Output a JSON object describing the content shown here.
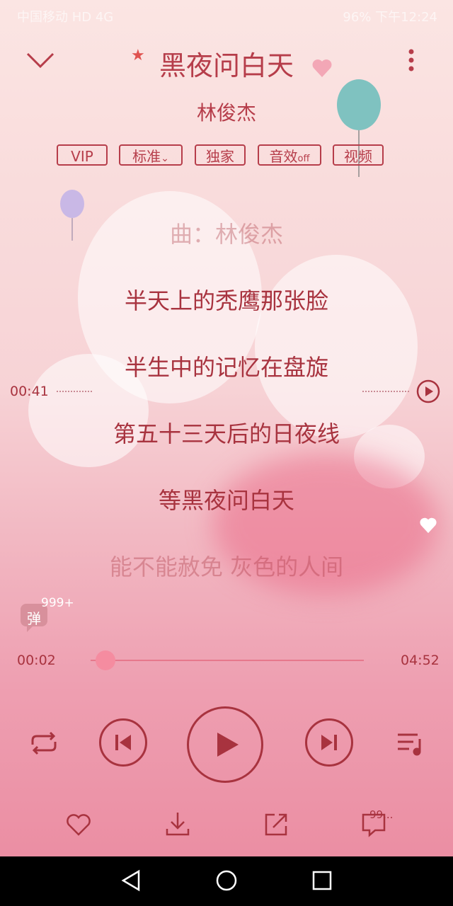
{
  "status_bar": {
    "left": "中国移动 HD 4G",
    "right": "96% 下午12:24"
  },
  "song": {
    "title": "黑夜问白天",
    "artist": "林俊杰"
  },
  "tags": {
    "vip": "VIP",
    "quality": "标准",
    "exclusive": "独家",
    "sound_effect": "音效",
    "sound_effect_state": "off",
    "video": "视频"
  },
  "lyrics": [
    {
      "text": "曲：林俊杰",
      "faded": true
    },
    {
      "text": "半天上的秃鹰那张脸",
      "faded": false
    },
    {
      "text": "半生中的记忆在盘旋",
      "faded": false
    },
    {
      "text": "第五十三天后的日夜线",
      "faded": false
    },
    {
      "text": "等黑夜问白天",
      "faded": false
    },
    {
      "text": "能不能赦免 灰色的人间",
      "faded": true
    }
  ],
  "lyric_seek_time": "00:41",
  "danmaku": {
    "label": "弹",
    "count": "999+"
  },
  "playback": {
    "current_time": "00:02",
    "total_time": "04:52",
    "progress": 0.007
  },
  "bottom": {
    "comments_count": "99..."
  },
  "colors": {
    "accent": "#b63d4a",
    "progress": "#e6788c"
  }
}
